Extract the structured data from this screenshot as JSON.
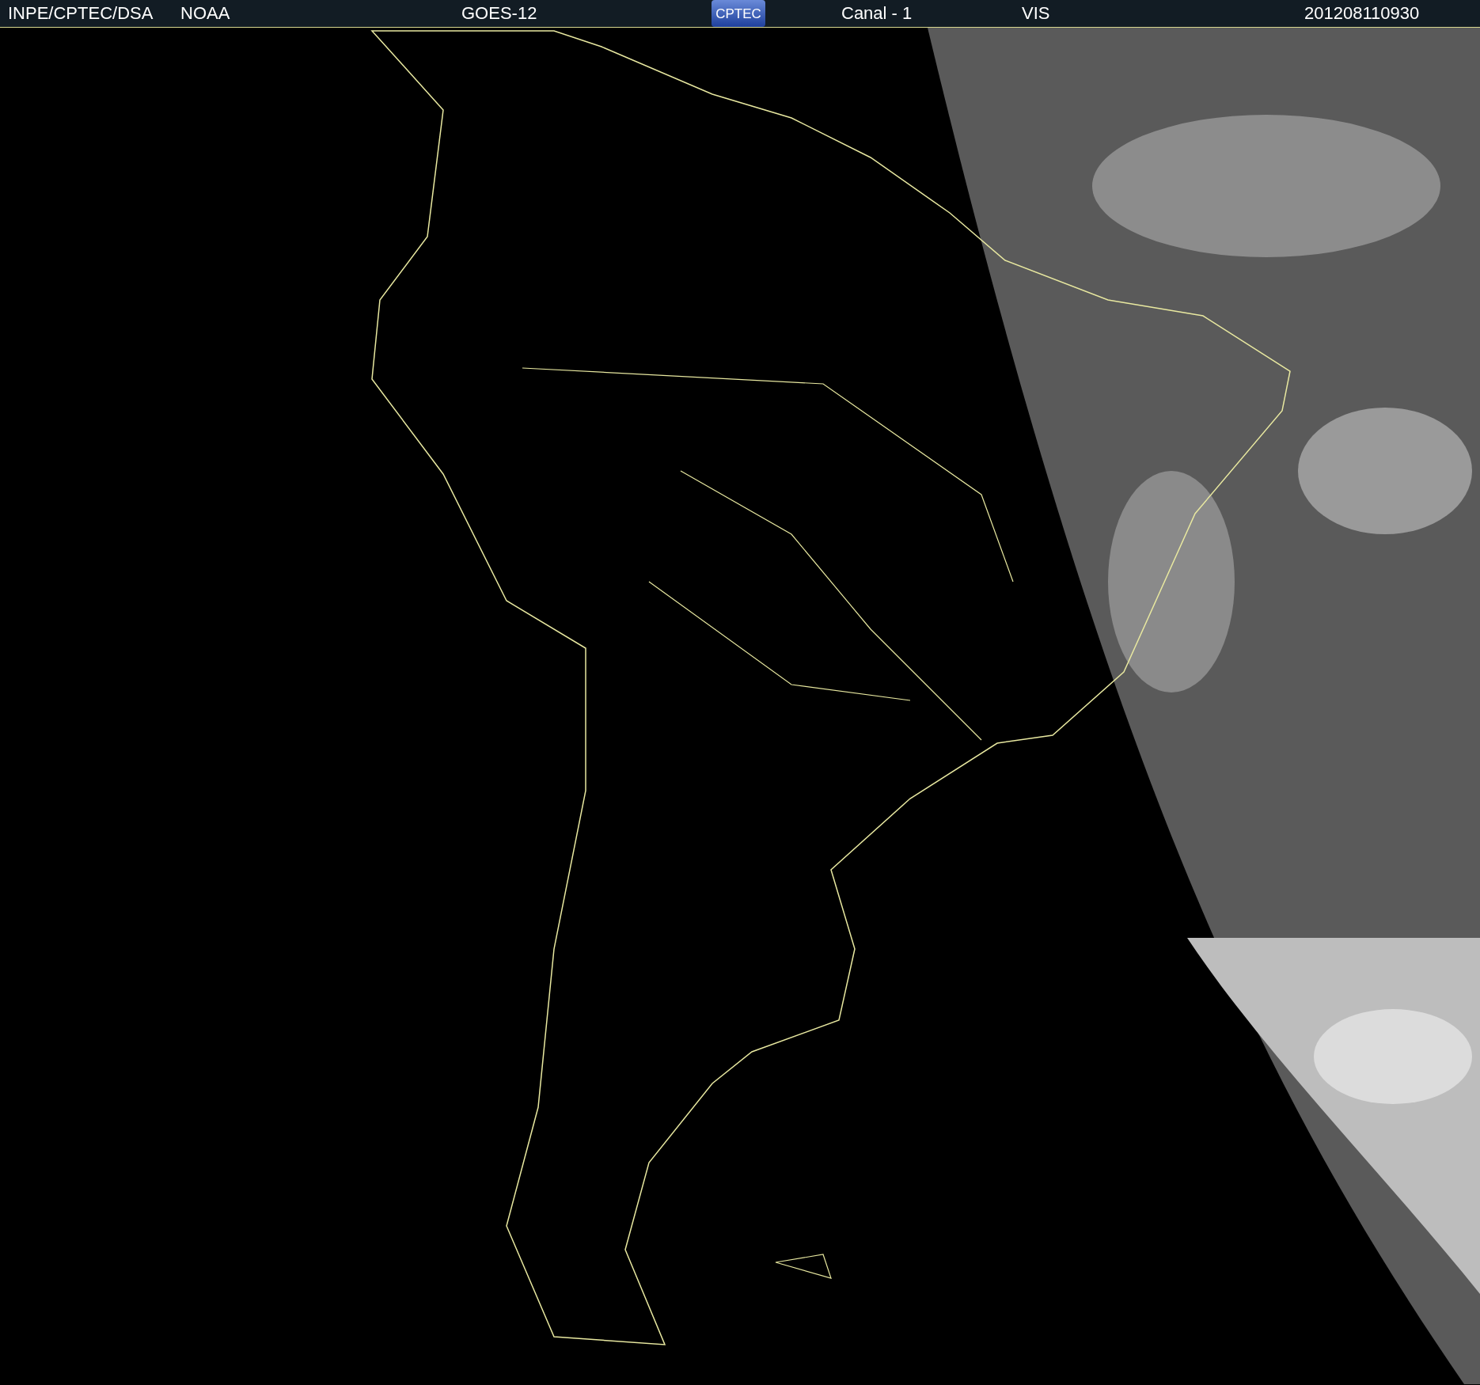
{
  "header": {
    "institution": "INPE/CPTEC/DSA",
    "agency": "NOAA",
    "satellite": "GOES-12",
    "logo": "CPTEC",
    "channel": "Canal - 1",
    "band": "VIS",
    "timestamp": "201208110930"
  }
}
